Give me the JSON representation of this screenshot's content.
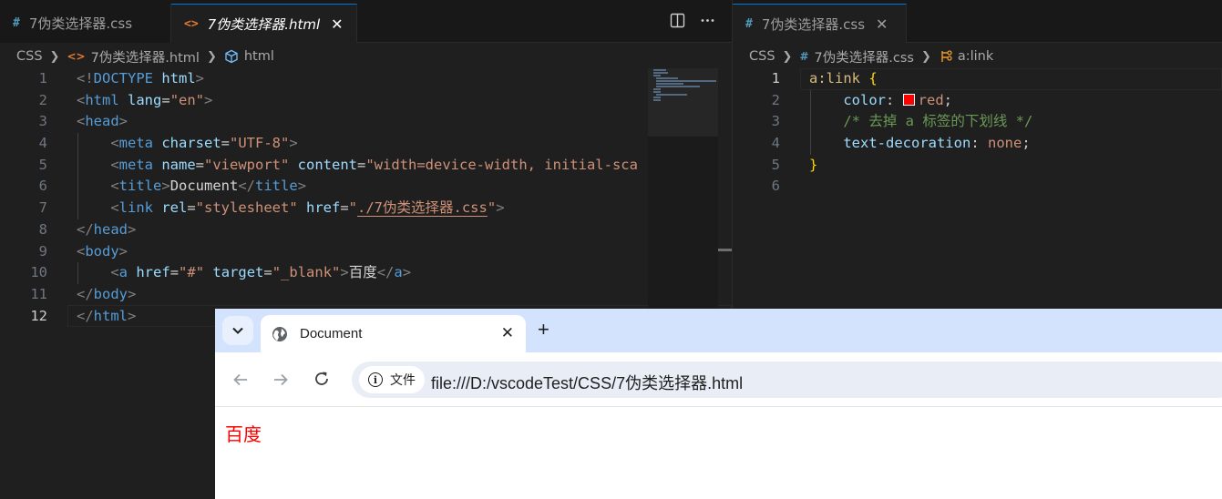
{
  "left_editor": {
    "tabs": [
      {
        "icon": "#",
        "label": "7伪类选择器.css",
        "close": ""
      },
      {
        "icon": "<>",
        "label": "7伪类选择器.html",
        "close": "✕"
      }
    ],
    "actions": [
      "split-editor",
      "more-actions"
    ],
    "breadcrumb": [
      "CSS",
      "7伪类选择器.html",
      "html"
    ],
    "line_numbers": [
      "1",
      "2",
      "3",
      "4",
      "5",
      "6",
      "7",
      "8",
      "9",
      "10",
      "11",
      "12"
    ],
    "code": {
      "l1": {
        "a": "<!",
        "b": "DOCTYPE",
        "c": " html",
        "d": ">"
      },
      "l2": {
        "a": "<",
        "b": "html",
        "c": " lang",
        "d": "=",
        "e": "\"en\"",
        "f": ">"
      },
      "l3": {
        "a": "<",
        "b": "head",
        "c": ">"
      },
      "l4": {
        "a": "<",
        "b": "meta",
        "c": " charset",
        "d": "=",
        "e": "\"UTF-8\"",
        "f": ">"
      },
      "l5": {
        "a": "<",
        "b": "meta",
        "c": " name",
        "d": "=",
        "e": "\"viewport\"",
        "f": " content",
        "g": "=",
        "h": "\"width=device-width, initial-sca"
      },
      "l6": {
        "a": "<",
        "b": "title",
        "c": ">",
        "d": "Document",
        "e": "</",
        "f": "title",
        "g": ">"
      },
      "l7": {
        "a": "<",
        "b": "link",
        "c": " rel",
        "d": "=",
        "e": "\"stylesheet\"",
        "f": " href",
        "g": "=",
        "h": "\"",
        "i": "./7伪类选择器.css",
        "j": "\"",
        "k": ">"
      },
      "l8": {
        "a": "</",
        "b": "head",
        "c": ">"
      },
      "l9": {
        "a": "<",
        "b": "body",
        "c": ">"
      },
      "l10": {
        "a": "<",
        "b": "a",
        "c": " href",
        "d": "=",
        "e": "\"#\"",
        "f": " target",
        "g": "=",
        "h": "\"_blank\"",
        "i": ">",
        "j": "百度",
        "k": "</",
        "l": "a",
        "m": ">"
      },
      "l11": {
        "a": "</",
        "b": "body",
        "c": ">"
      },
      "l12": {
        "a": "</",
        "b": "html",
        "c": ">"
      }
    }
  },
  "right_editor": {
    "tab": {
      "icon": "#",
      "label": "7伪类选择器.css",
      "close": "✕"
    },
    "breadcrumb": [
      "CSS",
      "7伪类选择器.css",
      "a:link"
    ],
    "line_numbers": [
      "1",
      "2",
      "3",
      "4",
      "5",
      "6"
    ],
    "code": {
      "l1": {
        "sel": "a:link",
        "brace": " {"
      },
      "l2": {
        "prop": "color",
        "colon": ": ",
        "val": "red",
        "semi": ";"
      },
      "l3": {
        "cmt": "/* 去掉 a 标签的下划线 */"
      },
      "l4": {
        "prop": "text-decoration",
        "colon": ": ",
        "val": "none",
        "semi": ";"
      },
      "l5": {
        "brace": "}"
      }
    },
    "swatch_color": "#ff0000"
  },
  "browser": {
    "tab_title": "Document",
    "close": "✕",
    "new_tab": "+",
    "security_chip": "文件",
    "url": "file:///D:/vscodeTest/CSS/7伪类选择器.html",
    "link_text": "百度",
    "link_color": "#ff0000"
  }
}
